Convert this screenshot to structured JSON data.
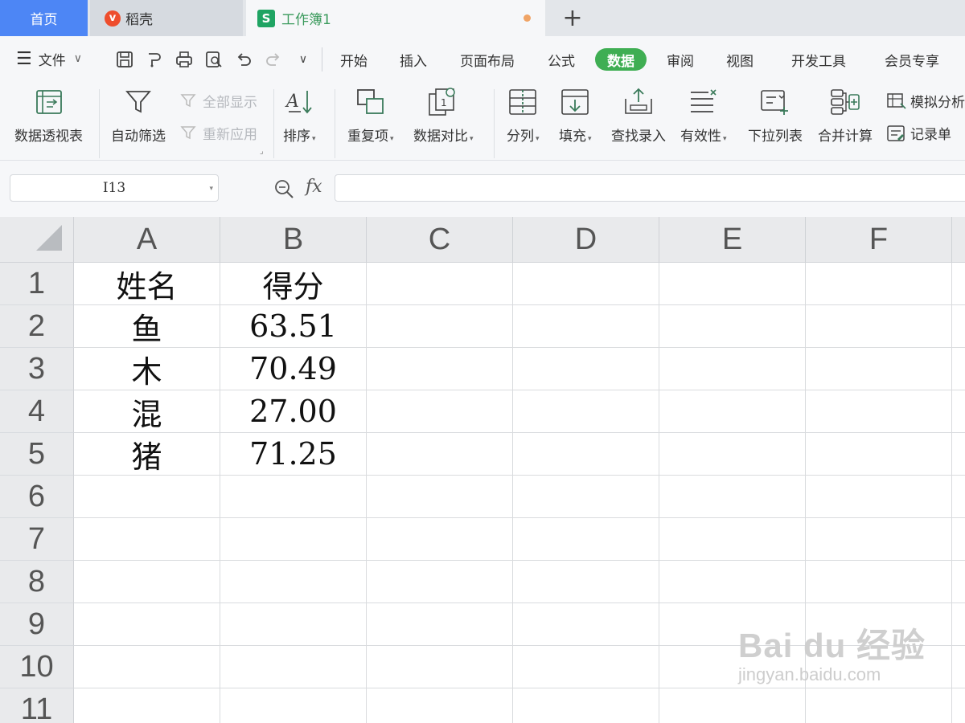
{
  "tabs": {
    "home": "首页",
    "daoke": "稻壳",
    "workbook": "工作簿1",
    "new_tab": "+"
  },
  "menu": {
    "file": "文件",
    "items": [
      "开始",
      "插入",
      "页面布局",
      "公式",
      "数据",
      "审阅",
      "视图",
      "开发工具",
      "会员专享"
    ],
    "active": "数据"
  },
  "ribbon": {
    "pivot": "数据透视表",
    "autofilter": "自动筛选",
    "show_all": "全部显示",
    "reapply": "重新应用",
    "sort": "排序",
    "duplicates": "重复项",
    "compare": "数据对比",
    "split": "分列",
    "fill": "填充",
    "lookup_entry": "查找录入",
    "validity": "有效性",
    "dropdown_list": "下拉列表",
    "consolidate": "合并计算",
    "simulate": "模拟分析",
    "record_form": "记录单"
  },
  "formula_bar": {
    "name_box": "I13",
    "fx": "fx",
    "formula": ""
  },
  "sheet": {
    "columns": [
      "A",
      "B",
      "C",
      "D",
      "E",
      "F"
    ],
    "rows": [
      "1",
      "2",
      "3",
      "4",
      "5",
      "6",
      "7",
      "8",
      "9",
      "10",
      "11"
    ],
    "cells": [
      [
        "姓名",
        "得分"
      ],
      [
        "鱼",
        "63.51"
      ],
      [
        "木",
        "70.49"
      ],
      [
        "混",
        "27.00"
      ],
      [
        "猪",
        "71.25"
      ]
    ]
  },
  "watermark": {
    "brand": "Bai du 经验",
    "url": "jingyan.baidu.com"
  },
  "colors": {
    "home_tab": "#4d86f5",
    "active_menu": "#3fae53",
    "workbook_tab_text": "#3a9a5c",
    "modified_dot": "#f0a466"
  }
}
